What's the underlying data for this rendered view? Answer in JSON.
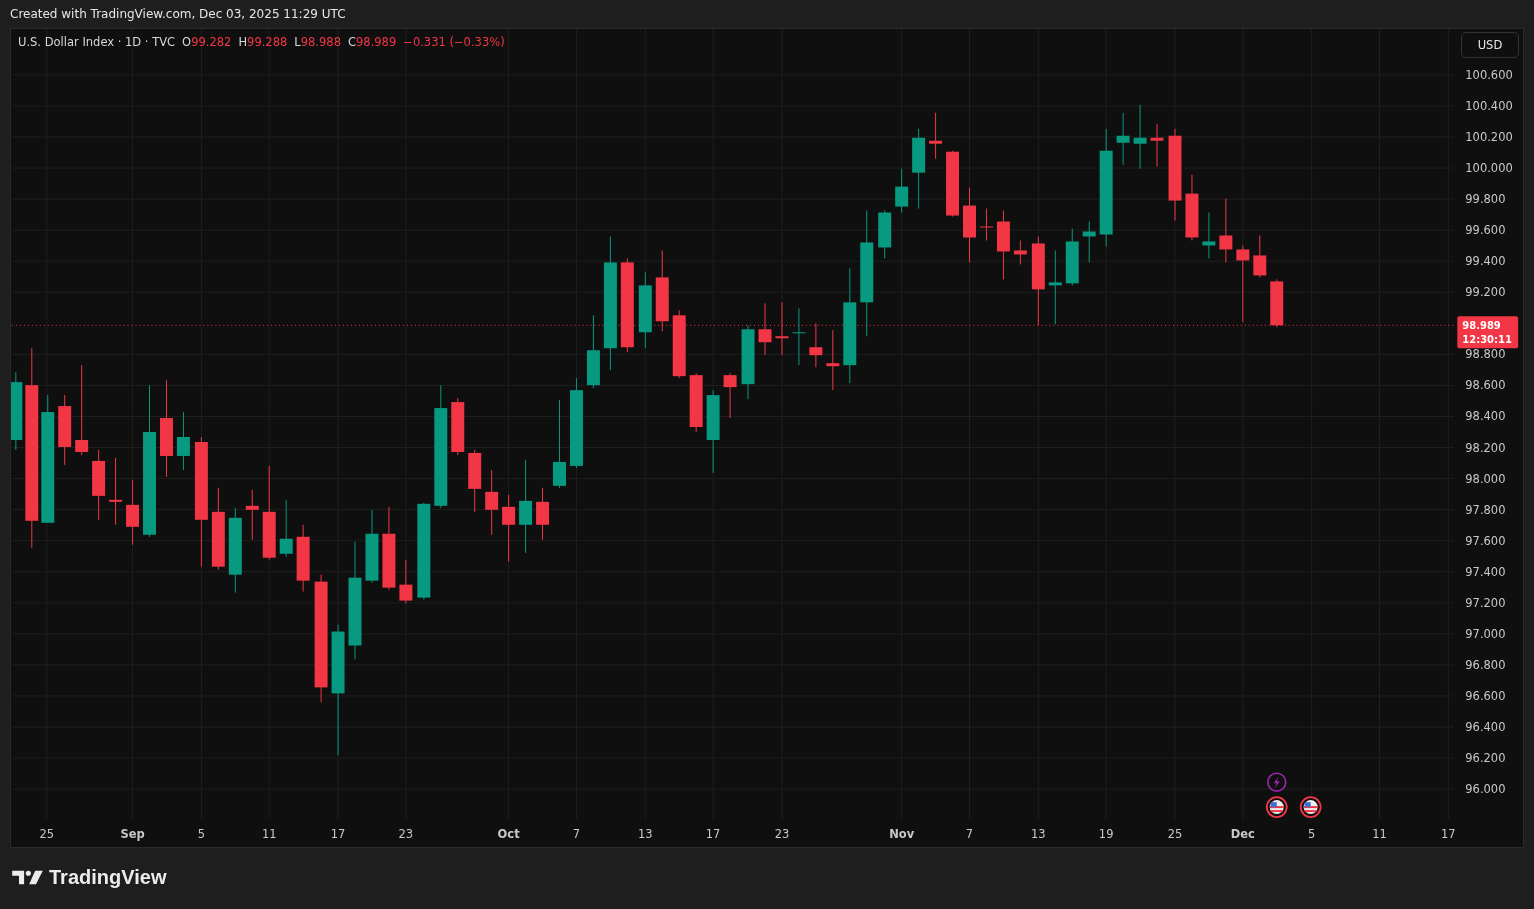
{
  "header": {
    "text": "Created with TradingView.com, Dec 03, 2025 11:29 UTC"
  },
  "legend": {
    "symbol": "U.S. Dollar Index · 1D · TVC",
    "values": [
      {
        "label": "O",
        "value": "99.282"
      },
      {
        "label": "H",
        "value": "99.288"
      },
      {
        "label": "L",
        "value": "98.988"
      },
      {
        "label": "C",
        "value": "98.989"
      }
    ],
    "change": "−0.331 (−0.33%)"
  },
  "currency_button": "USD",
  "price_axis": [
    "100.600",
    "100.400",
    "100.200",
    "100.000",
    "99.800",
    "99.600",
    "99.400",
    "99.200",
    "98.800",
    "98.600",
    "98.400",
    "98.200",
    "98.000",
    "97.800",
    "97.600",
    "97.400",
    "97.200",
    "97.000",
    "96.800",
    "96.600",
    "96.400",
    "96.200",
    "96.000"
  ],
  "last_price": {
    "price": "98.989",
    "countdown": "12:30:11"
  },
  "time_axis": [
    {
      "label": "25",
      "bold": false
    },
    {
      "label": "Sep",
      "bold": true
    },
    {
      "label": "5",
      "bold": false
    },
    {
      "label": "11",
      "bold": false
    },
    {
      "label": "17",
      "bold": false
    },
    {
      "label": "23",
      "bold": false
    },
    {
      "label": "Oct",
      "bold": true
    },
    {
      "label": "7",
      "bold": false
    },
    {
      "label": "13",
      "bold": false
    },
    {
      "label": "17",
      "bold": false
    },
    {
      "label": "23",
      "bold": false
    },
    {
      "label": "Nov",
      "bold": true
    },
    {
      "label": "7",
      "bold": false
    },
    {
      "label": "13",
      "bold": false
    },
    {
      "label": "19",
      "bold": false
    },
    {
      "label": "25",
      "bold": false
    },
    {
      "label": "Dec",
      "bold": true
    },
    {
      "label": "5",
      "bold": false
    },
    {
      "label": "11",
      "bold": false
    },
    {
      "label": "17",
      "bold": false
    }
  ],
  "events": [
    {
      "kind": "flash"
    },
    {
      "kind": "flag"
    },
    {
      "kind": "flag"
    }
  ],
  "logo": "TradingView"
}
